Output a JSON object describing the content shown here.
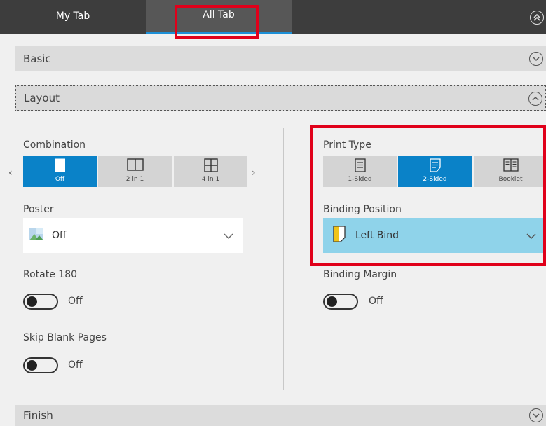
{
  "tabs": {
    "my_tab": "My Tab",
    "all_tab": "All Tab"
  },
  "sections": {
    "basic": "Basic",
    "layout": "Layout",
    "finish": "Finish"
  },
  "combination": {
    "label": "Combination",
    "options": [
      "Off",
      "2 in 1",
      "4 in 1"
    ],
    "selected": "Off"
  },
  "poster": {
    "label": "Poster",
    "value": "Off"
  },
  "rotate": {
    "label": "Rotate 180",
    "state": "Off"
  },
  "skip_blank": {
    "label": "Skip Blank Pages",
    "state": "Off"
  },
  "print_type": {
    "label": "Print Type",
    "options": [
      "1-Sided",
      "2-Sided",
      "Booklet"
    ],
    "selected": "2-Sided"
  },
  "binding_position": {
    "label": "Binding Position",
    "value": "Left Bind"
  },
  "binding_margin": {
    "label": "Binding Margin",
    "state": "Off"
  },
  "colors": {
    "accent": "#0a82c8",
    "highlight": "#e0001a",
    "bind_dropdown": "#8fd3ea"
  }
}
